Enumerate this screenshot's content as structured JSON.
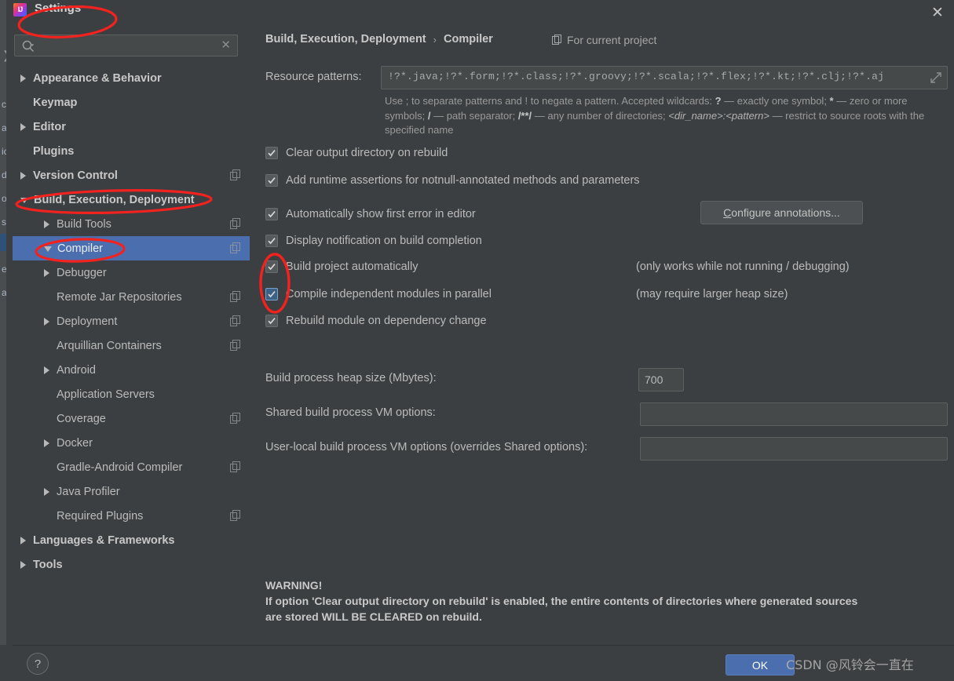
{
  "window": {
    "title": "Settings",
    "app_icon": "intellij-idea-icon",
    "close_label": "✕"
  },
  "search": {
    "value": "",
    "placeholder": "",
    "icon": "search-icon",
    "clear_icon": "✕"
  },
  "sidebar": {
    "items": [
      {
        "label": "Appearance & Behavior",
        "arrow": "right",
        "indent": 0,
        "bold": true,
        "copy": false,
        "selected": false
      },
      {
        "label": "Keymap",
        "arrow": "none",
        "indent": 0,
        "bold": true,
        "copy": false,
        "selected": false
      },
      {
        "label": "Editor",
        "arrow": "right",
        "indent": 0,
        "bold": true,
        "copy": false,
        "selected": false
      },
      {
        "label": "Plugins",
        "arrow": "none",
        "indent": 0,
        "bold": true,
        "copy": false,
        "selected": false
      },
      {
        "label": "Version Control",
        "arrow": "right",
        "indent": 0,
        "bold": true,
        "copy": true,
        "selected": false
      },
      {
        "label": "Build, Execution, Deployment",
        "arrow": "down",
        "indent": 0,
        "bold": true,
        "copy": false,
        "selected": false
      },
      {
        "label": "Build Tools",
        "arrow": "right",
        "indent": 1,
        "bold": false,
        "copy": true,
        "selected": false
      },
      {
        "label": "Compiler",
        "arrow": "down",
        "indent": 1,
        "bold": false,
        "copy": true,
        "selected": true
      },
      {
        "label": "Debugger",
        "arrow": "right",
        "indent": 1,
        "bold": false,
        "copy": false,
        "selected": false
      },
      {
        "label": "Remote Jar Repositories",
        "arrow": "none",
        "indent": 1,
        "bold": false,
        "copy": true,
        "selected": false
      },
      {
        "label": "Deployment",
        "arrow": "right",
        "indent": 1,
        "bold": false,
        "copy": true,
        "selected": false
      },
      {
        "label": "Arquillian Containers",
        "arrow": "none",
        "indent": 1,
        "bold": false,
        "copy": true,
        "selected": false
      },
      {
        "label": "Android",
        "arrow": "right",
        "indent": 1,
        "bold": false,
        "copy": false,
        "selected": false
      },
      {
        "label": "Application Servers",
        "arrow": "none",
        "indent": 1,
        "bold": false,
        "copy": false,
        "selected": false
      },
      {
        "label": "Coverage",
        "arrow": "none",
        "indent": 1,
        "bold": false,
        "copy": true,
        "selected": false
      },
      {
        "label": "Docker",
        "arrow": "right",
        "indent": 1,
        "bold": false,
        "copy": false,
        "selected": false
      },
      {
        "label": "Gradle-Android Compiler",
        "arrow": "none",
        "indent": 1,
        "bold": false,
        "copy": true,
        "selected": false
      },
      {
        "label": "Java Profiler",
        "arrow": "right",
        "indent": 1,
        "bold": false,
        "copy": false,
        "selected": false
      },
      {
        "label": "Required Plugins",
        "arrow": "none",
        "indent": 1,
        "bold": false,
        "copy": true,
        "selected": false
      },
      {
        "label": "Languages & Frameworks",
        "arrow": "right",
        "indent": 0,
        "bold": true,
        "copy": false,
        "selected": false
      },
      {
        "label": "Tools",
        "arrow": "right",
        "indent": 0,
        "bold": true,
        "copy": false,
        "selected": false
      }
    ]
  },
  "breadcrumb": {
    "root": "Build, Execution, Deployment",
    "separator": "›",
    "current": "Compiler"
  },
  "scope": {
    "icon": "project-scope-icon",
    "label": "For current project"
  },
  "resource_patterns": {
    "label": "Resource patterns:",
    "value": "!?*.java;!?*.form;!?*.class;!?*.groovy;!?*.scala;!?*.flex;!?*.kt;!?*.clj;!?*.aj",
    "expand_icon": "expand-icon",
    "help_line1_a": "Use ; to separate patterns and ! to negate a pattern. Accepted wildcards: ",
    "help_q": "?",
    "help_line1_b": " — exactly one symbol; ",
    "help_star": "*",
    "help_line1_c": " — zero or",
    "help_line2_a": "more symbols; ",
    "help_slash": "/",
    "help_line2_b": " — path separator; ",
    "help_globstar": "/**/",
    "help_line2_c": " — any number of directories; ",
    "help_dirname": "<dir_name>:<pattern>",
    "help_line2_d": " — restrict to source",
    "help_line3": "roots with the specified name"
  },
  "checkboxes": [
    {
      "label": "Clear output directory on rebuild",
      "checked": true,
      "focused": false,
      "hint": ""
    },
    {
      "label": "Add runtime assertions for notnull-annotated methods and parameters",
      "checked": true,
      "focused": false,
      "hint": ""
    },
    {
      "label": "Automatically show first error in editor",
      "checked": true,
      "focused": false,
      "hint": ""
    },
    {
      "label": "Display notification on build completion",
      "checked": true,
      "focused": false,
      "hint": ""
    },
    {
      "label": "Build project automatically",
      "checked": true,
      "focused": false,
      "hint": "(only works while not running / debugging)"
    },
    {
      "label": "Compile independent modules in parallel",
      "checked": true,
      "focused": true,
      "hint": "(may require larger heap size)"
    },
    {
      "label": "Rebuild module on dependency change",
      "checked": true,
      "focused": false,
      "hint": ""
    }
  ],
  "configure_button": {
    "label": "Configure annotations..."
  },
  "fields": [
    {
      "label": "Build process heap size (Mbytes):",
      "value": "700"
    },
    {
      "label": "Shared build process VM options:",
      "value": ""
    },
    {
      "label": "User-local build process VM options (overrides Shared options):",
      "value": ""
    }
  ],
  "warning": {
    "title": "WARNING!",
    "line1": "If option 'Clear output directory on rebuild' is enabled, the entire contents of directories where generated sources",
    "line2": "are stored WILL BE CLEARED on rebuild."
  },
  "bottom": {
    "help_label": "?",
    "ok_label": "OK",
    "watermark": "CSDN @风铃会一直在"
  },
  "annotations": {
    "color": "#f2221f",
    "shapes": [
      "ellipse-settings-title",
      "ellipse-build-execution-deployment",
      "ellipse-compiler",
      "ellipse-two-checkboxes"
    ]
  },
  "colors": {
    "dialog_bg": "#3c3f41",
    "selection_blue": "#4b6eaf",
    "accent_red": "#f2221f",
    "text": "#bbbbbb"
  }
}
